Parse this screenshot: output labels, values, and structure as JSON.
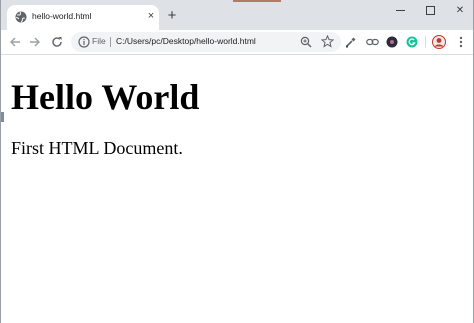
{
  "tab": {
    "title": "hello-world.html",
    "close_glyph": "×",
    "favicon": "globe-icon"
  },
  "new_tab_glyph": "+",
  "window_controls": {
    "minimize": "minimize-icon",
    "maximize": "maximize-icon",
    "close_glyph": "✕"
  },
  "toolbar": {
    "back": "back-arrow-icon",
    "forward": "forward-arrow-icon",
    "reload": "reload-icon",
    "omnibox": {
      "scheme_label": "File",
      "url": "C:/Users/pc/Desktop/hello-world.html"
    },
    "zoom": "zoom-icon",
    "bookmark": "star-icon",
    "extensions": [
      "eyedropper-icon",
      "link-icon",
      "dark-circle-extension-icon",
      "grammarly-icon"
    ],
    "menu": "more-vert-icon"
  },
  "page": {
    "heading": "Hello World",
    "paragraph": "First HTML Document."
  },
  "colors": {
    "tabstrip": "#dee1e6",
    "omnibox": "#f1f3f4",
    "grammarly": "#15c39a"
  }
}
